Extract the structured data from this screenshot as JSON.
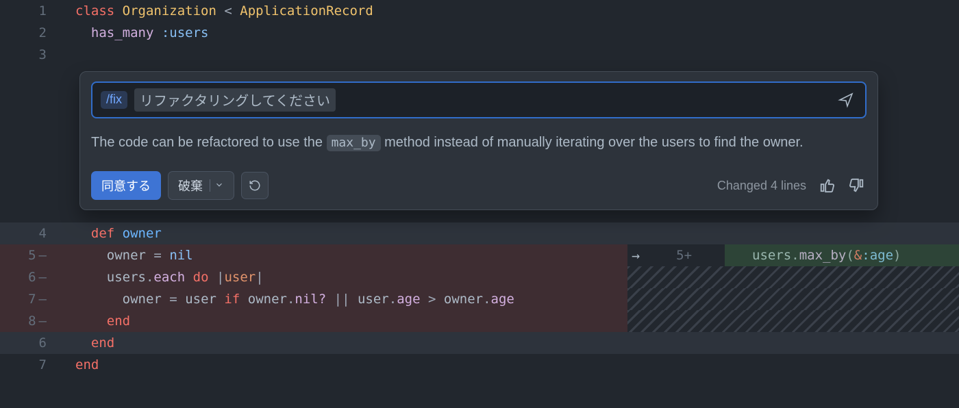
{
  "lines": {
    "l1": {
      "num": "1"
    },
    "l2": {
      "num": "2"
    },
    "l3": {
      "num": "3"
    },
    "l4": {
      "num": "4"
    },
    "l5": {
      "num": "5"
    },
    "l6": {
      "num": "6"
    },
    "l7": {
      "num": "7"
    },
    "l8": {
      "num": "8"
    },
    "l6b": {
      "num": "6"
    },
    "l7b": {
      "num": "7"
    },
    "r5": {
      "num": "5"
    }
  },
  "code": {
    "l1": {
      "kw1": "class",
      "cls": "Organization",
      "lt": "<",
      "sup": "ApplicationRecord"
    },
    "l2": {
      "fn": "has_many",
      "sym": ":users"
    },
    "l4": {
      "kw": "def",
      "name": "owner"
    },
    "l5": {
      "lhs": "owner",
      "eq": "=",
      "rhs": "nil"
    },
    "l6": {
      "recv": "users",
      "dot": ".",
      "each": "each",
      "do": "do",
      "bar1": "|",
      "arg": "user",
      "bar2": "|"
    },
    "l7": {
      "lhs": "owner",
      "eq": "=",
      "user": "user",
      "if": "if",
      "owner1": "owner",
      "dot1": ".",
      "nilq": "nil?",
      "or": "||",
      "user2": "user",
      "dot2": ".",
      "age1": "age",
      "gt": ">",
      "owner2": "owner",
      "dot3": ".",
      "age2": "age"
    },
    "l8": {
      "end": "end"
    },
    "l6b": {
      "end": "end"
    },
    "l7b": {
      "end": "end"
    },
    "r5": {
      "recv": "users",
      "dot": ".",
      "maxby": "max_by",
      "open": "(",
      "amp": "&",
      "sym": ":age",
      "close": ")"
    }
  },
  "panel": {
    "slash": "/fix",
    "prompt": "リファクタリングしてください",
    "explain_before": "The code can be refactored to use the ",
    "explain_code": "max_by",
    "explain_after": " method instead of manually iterating over the users to find the owner.",
    "accept": "同意する",
    "discard": "破棄",
    "changed": "Changed 4 lines"
  }
}
